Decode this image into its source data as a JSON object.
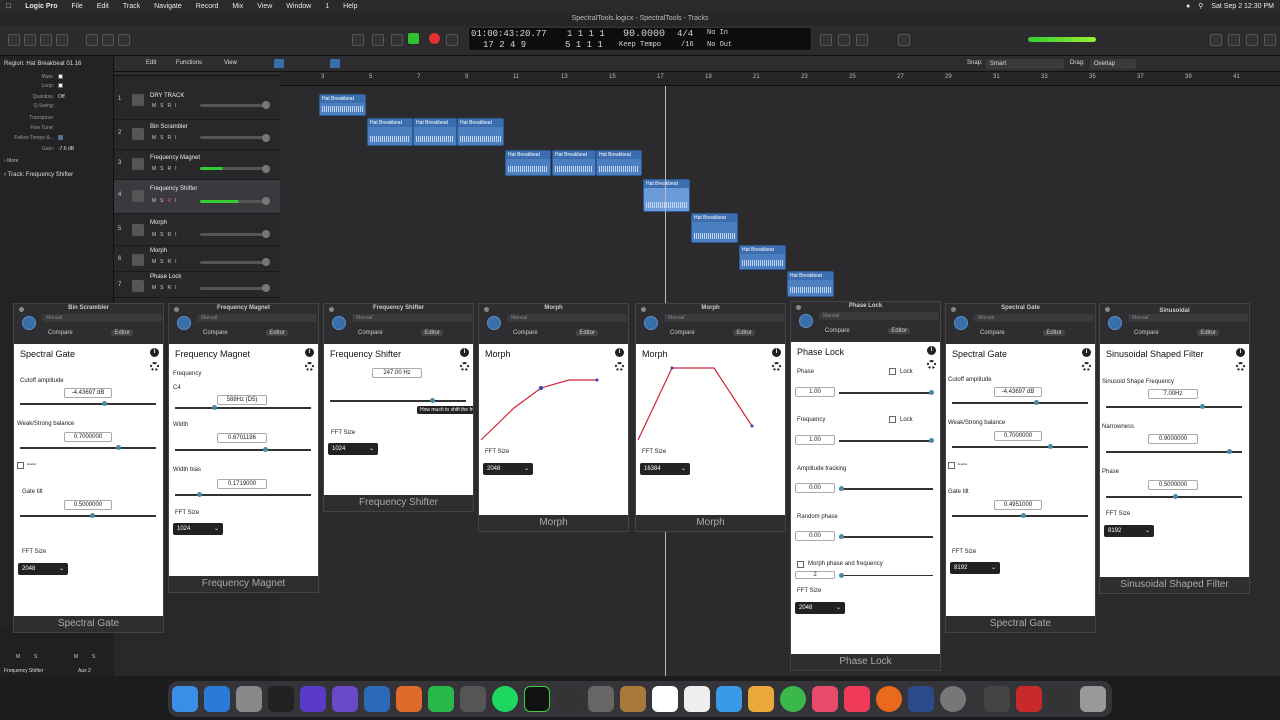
{
  "menubar": {
    "app": "Logic Pro",
    "items": [
      "File",
      "Edit",
      "Track",
      "Navigate",
      "Record",
      "Mix",
      "View",
      "Window",
      "1",
      "Help"
    ],
    "clock": "Sat Sep 2  12:30 PM"
  },
  "window_title": "SpectralTools.logicx - SpectralTools - Tracks",
  "lcd": {
    "time": "01:00:43:20.77",
    "bars": "1  1  1    1",
    "bars2": "17  2  4     9",
    "bars3": "5  1  1    1",
    "tempo": "90.0000",
    "tempo_mode": "Keep Tempo",
    "sig": "4/4",
    "division": "/16",
    "in": "No In",
    "out": "No Out"
  },
  "arrange_toolbar": {
    "edit": "Edit",
    "functions": "Functions",
    "view": "View",
    "snap_label": "Snap:",
    "snap": "Smart",
    "drag_label": "Drag:",
    "drag": "Overlap"
  },
  "inspector": {
    "region": "Region: Hat Breakbeat 01.16",
    "rows": [
      {
        "k": "Mute:",
        "v": ""
      },
      {
        "k": "Loop:",
        "v": ""
      },
      {
        "k": "Quantize:",
        "v": "Off"
      },
      {
        "k": "Q-Swing:",
        "v": ""
      },
      {
        "k": "Transpose:",
        "v": ""
      },
      {
        "k": "Fine Tune:",
        "v": ""
      },
      {
        "k": "Follow Tempo &...",
        "v": ""
      },
      {
        "k": "Gain:",
        "v": "-7.6 dB"
      }
    ],
    "more": "More",
    "track_label": "Track:",
    "track": "Frequency Shifter",
    "bottom_left": "Frequency Shifter",
    "bottom_right": "Aux 2",
    "mute_short": "M",
    "solo_short": "S"
  },
  "ruler": [
    "3",
    "5",
    "7",
    "9",
    "11",
    "13",
    "15",
    "17",
    "19",
    "21",
    "23",
    "25",
    "27",
    "29",
    "31",
    "33",
    "35",
    "37",
    "39",
    "41"
  ],
  "tracks": [
    {
      "num": "1",
      "name": "DRY TRACK"
    },
    {
      "num": "2",
      "name": "Bin Scrambler"
    },
    {
      "num": "3",
      "name": "Frequency Magnet"
    },
    {
      "num": "4",
      "name": "Frequency Shifter"
    },
    {
      "num": "5",
      "name": "Morph"
    },
    {
      "num": "6",
      "name": "Morph"
    },
    {
      "num": "7",
      "name": "Phase Lock"
    }
  ],
  "msr": [
    "M",
    "S",
    "R",
    "I"
  ],
  "region_name": "Hat Breakbeat",
  "plugins": {
    "common": {
      "manual": "Manual",
      "compare": "Compare",
      "editor": "Editor"
    },
    "p1": {
      "win": "Bin Scrambler",
      "title": "Spectral Gate",
      "cutoff_label": "Cutoff amplitude",
      "cutoff": "-4.43697 dB",
      "ws_label": "Weak/Strong balance",
      "ws": "0.7000000",
      "enable": "Enable",
      "tilt_label": "Gate tilt",
      "tilt": "0.5000000",
      "fft_label": "FFT Size",
      "fft": "2048",
      "foot": "Spectral Gate"
    },
    "p2": {
      "win": "Frequency Magnet",
      "title": "Frequency Magnet",
      "freq_label": "Frequency",
      "note": "C4",
      "freq": "588Hz (D5)",
      "width_label": "Width",
      "width": "0.6701196",
      "bias_label": "Width bias",
      "bias": "0.1719000",
      "fft_label": "FFT Size",
      "fft": "1024",
      "foot": "Frequency Magnet"
    },
    "p3": {
      "win": "Frequency Shifter",
      "title": "Frequency Shifter",
      "shift": "247.00 Hz",
      "tooltip": "How much to shift the frequencies by",
      "fft_label": "FFT Size",
      "fft": "1024",
      "foot": "Frequency Shifter"
    },
    "p4": {
      "win": "Morph",
      "title": "Morph",
      "fft_label": "FFT Size",
      "fft": "2048",
      "foot": "Morph"
    },
    "p5": {
      "win": "Morph",
      "title": "Morph",
      "fft_label": "FFT Size",
      "fft": "16384",
      "foot": "Morph"
    },
    "p6": {
      "win": "Phase Lock",
      "title": "Phase Lock",
      "phase_label": "Phase",
      "lock": "Lock",
      "phase": "1.00",
      "freq_label": "Frequency",
      "freq": "1.00",
      "amp_label": "Amplitude tracking",
      "amp": "0.00",
      "rand_label": "Random phase",
      "rand": "0.00",
      "morph_label": "Morph phase and frequency",
      "morph": "2",
      "fft_label": "FFT Size",
      "fft": "2048",
      "foot": "Phase Lock"
    },
    "p7": {
      "win": "Spectral Gate",
      "title": "Spectral Gate",
      "cutoff_label": "Cutoff amplitude",
      "cutoff": "-4.43697 dB",
      "ws_label": "Weak/Strong balance",
      "ws": "0.7000000",
      "enable": "Enable",
      "tilt_label": "Gate tilt",
      "tilt": "0.4951000",
      "fft_label": "FFT Size",
      "fft": "8192",
      "foot": "Spectral Gate"
    },
    "p8": {
      "win": "Sinusoidal",
      "title": "Sinusoidal Shaped Filter",
      "shape_label": "Sinusoid Shape Frequency",
      "shape": "7.00Hz",
      "narrow_label": "Narrowness",
      "narrow": "0.9000000",
      "phase_label": "Phase",
      "phase": "0.5000000",
      "fft_label": "FFT Size",
      "fft": "8192",
      "foot": "Sinusoidal Shaped Filter"
    }
  }
}
